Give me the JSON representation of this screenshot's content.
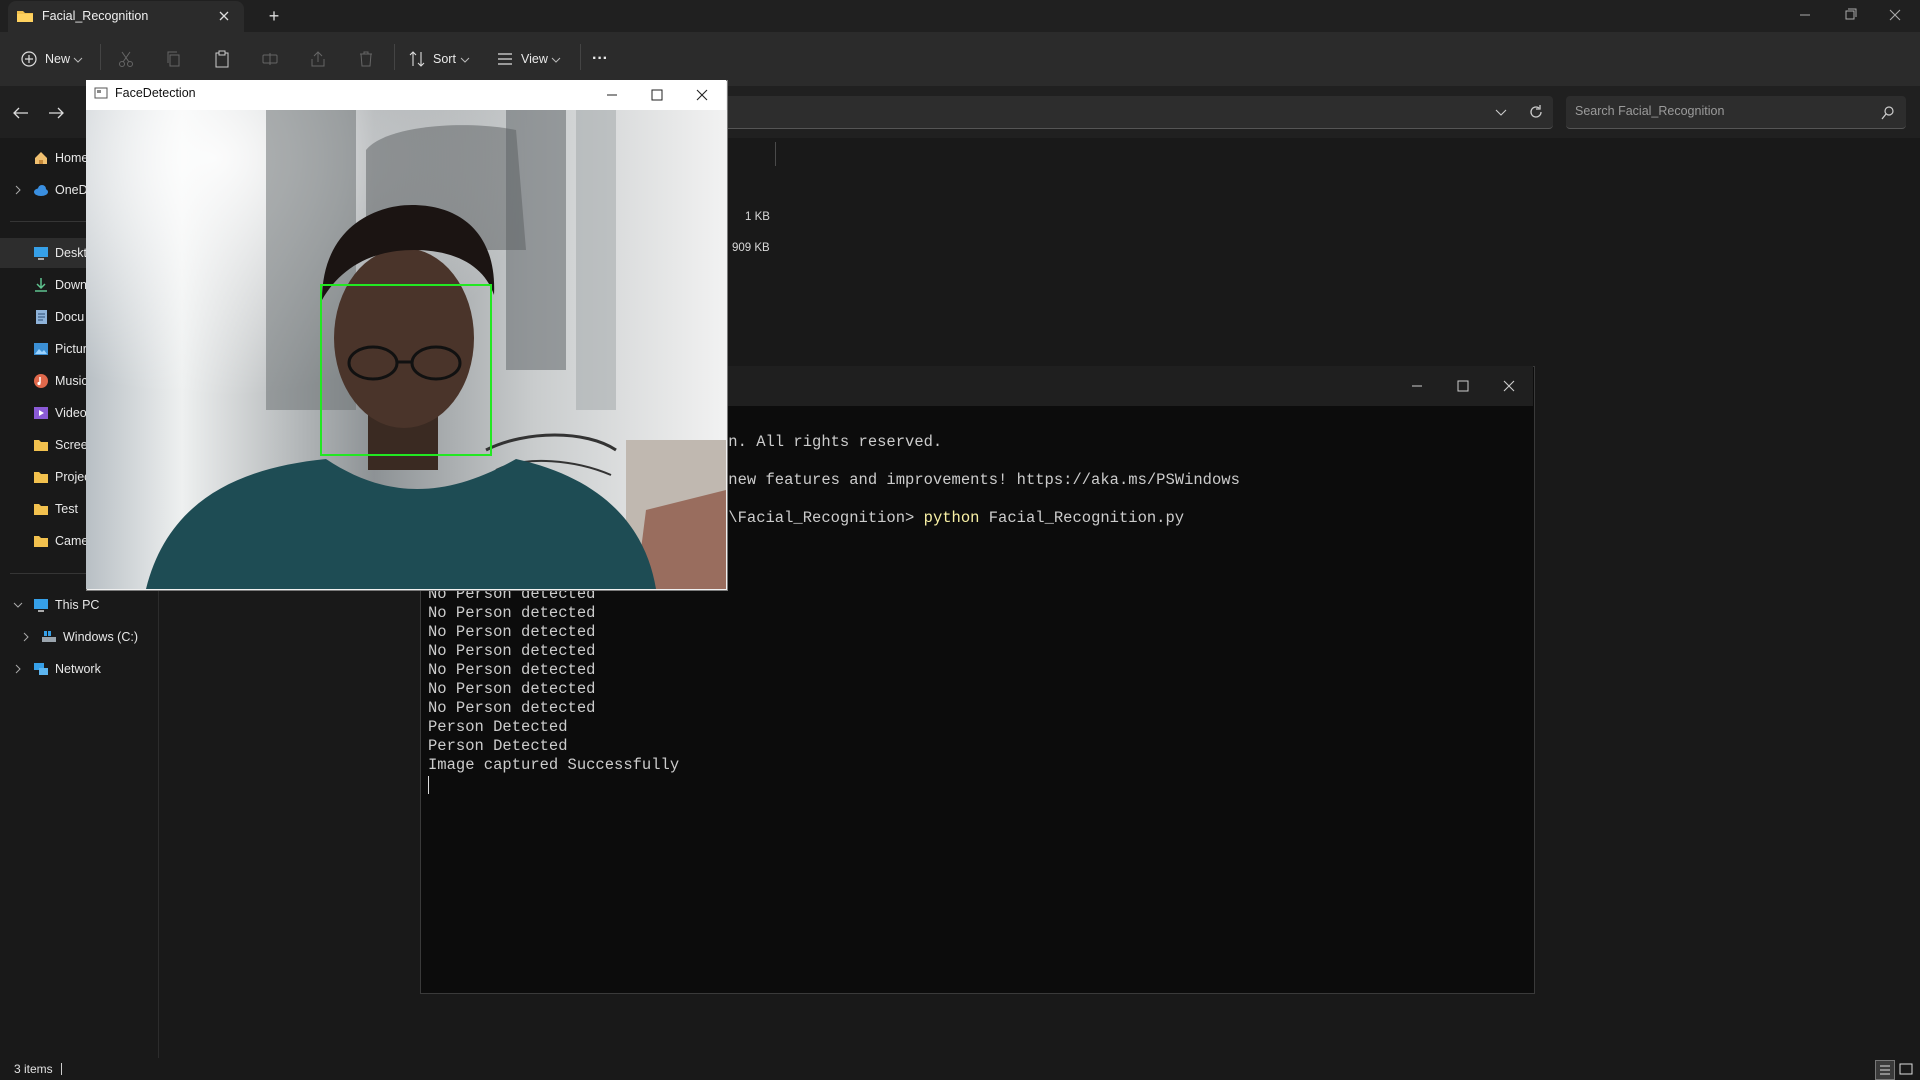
{
  "explorer": {
    "tab_title": "Facial_Recognition",
    "new_tab_label": "+",
    "toolbar": {
      "new_label": "New",
      "sort_label": "Sort",
      "view_label": "View",
      "more_label": "···"
    },
    "search_placeholder": "Search Facial_Recognition",
    "sidebar": {
      "items": [
        {
          "label": "Home",
          "icon": "home-icon"
        },
        {
          "label": "OneD",
          "icon": "cloud-icon"
        },
        {
          "label": "Deskt",
          "icon": "desktop-icon"
        },
        {
          "label": "Down",
          "icon": "download-icon"
        },
        {
          "label": "Docu",
          "icon": "document-icon"
        },
        {
          "label": "Pictur",
          "icon": "pictures-icon"
        },
        {
          "label": "Music",
          "icon": "music-icon"
        },
        {
          "label": "Video",
          "icon": "video-icon"
        },
        {
          "label": "Screer",
          "icon": "folder-icon"
        },
        {
          "label": "Projec",
          "icon": "folder-icon"
        },
        {
          "label": "Test",
          "icon": "folder-icon"
        },
        {
          "label": "Came",
          "icon": "folder-icon"
        },
        {
          "label": "This PC",
          "icon": "pc-icon"
        },
        {
          "label": "Windows (C:)",
          "icon": "drive-icon"
        },
        {
          "label": "Network",
          "icon": "network-icon"
        }
      ]
    },
    "files": {
      "sizes": [
        "1 KB",
        "909 KB"
      ]
    },
    "status": "3 items"
  },
  "terminal": {
    "lines": [
      "on. All rights reserved.",
      " new features and improvements! https://aka.ms/PSWindows",
      "s\\Facial_Recognition> "
    ],
    "command": "python",
    "command_args": " Facial_Recognition.py",
    "output": [
      "No Person detected",
      "No Person detected",
      "No Person detected",
      "No Person detected",
      "No Person detected",
      "No Person detected",
      "No Person detected",
      "Person Detected",
      "Person Detected",
      "Image captured Successfully"
    ]
  },
  "face_window": {
    "title": "FaceDetection"
  },
  "colors": {
    "face_box": "#22e822",
    "terminal_bg": "#0c0c0c",
    "command_yellow": "#f9f1a5"
  }
}
